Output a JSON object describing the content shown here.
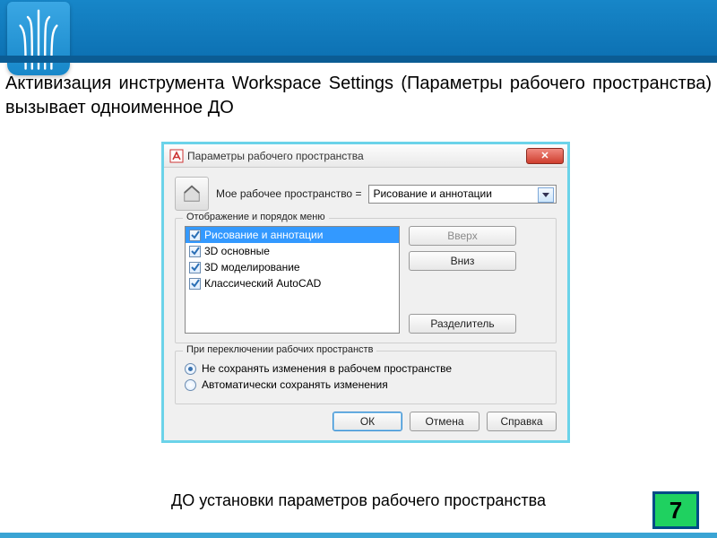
{
  "slide": {
    "title": "Активизация инструмента Workspace Settings (Параметры рабочего пространства) вызывает одноименное ДО",
    "caption": "ДО установки параметров рабочего пространства",
    "page": "7"
  },
  "dialog": {
    "title": "Параметры рабочего пространства",
    "close": "✕",
    "equals_label": "Мое рабочее пространство =",
    "combo_value": "Рисование и аннотации",
    "group_display": "Отображение и порядок меню",
    "list": [
      "Рисование и аннотации",
      "3D основные",
      "3D моделирование",
      "Классический AutoCAD"
    ],
    "btn_up": "Вверх",
    "btn_down": "Вниз",
    "btn_separator": "Разделитель",
    "group_switch": "При переключении рабочих пространств",
    "radio_nosave": "Не сохранять изменения в рабочем пространстве",
    "radio_autosave": "Автоматически сохранять изменения",
    "btn_ok": "ОК",
    "btn_cancel": "Отмена",
    "btn_help": "Справка"
  }
}
